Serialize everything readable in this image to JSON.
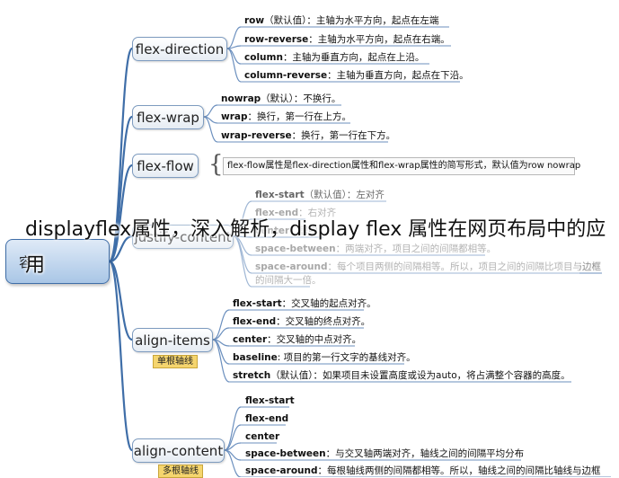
{
  "caption": "displayflex属性，深入解析，display flex 属性在网页布局中的应用",
  "root": {
    "label": "容"
  },
  "branches": [
    {
      "id": "flex-direction",
      "label": "flex-direction",
      "leaves": [
        {
          "key": "row",
          "text": "（默认值）：主轴为水平方向，起点在左端"
        },
        {
          "key": "row-reverse",
          "text": "：主轴为水平方向，起点在右端。"
        },
        {
          "key": "column",
          "text": "：主轴为垂直方向，起点在上沿。"
        },
        {
          "key": "column-reverse",
          "text": "：主轴为垂直方向，起点在下沿。"
        }
      ]
    },
    {
      "id": "flex-wrap",
      "label": "flex-wrap",
      "leaves": [
        {
          "key": "nowrap",
          "text": "（默认）：不换行。"
        },
        {
          "key": "wrap",
          "text": "：换行，第一行在上方。"
        },
        {
          "key": "wrap-reverse",
          "text": "：换行，第一行在下方。"
        }
      ]
    },
    {
      "id": "flex-flow",
      "label": "flex-flow",
      "note": "flex-flow属性是flex-direction属性和flex-wrap属性的简写形式，默认值为row nowrap"
    },
    {
      "id": "justify-content",
      "label": "justify-content",
      "leaves": [
        {
          "key": "flex-start",
          "text": "（默认值）：左对齐"
        },
        {
          "key": "flex-end",
          "text": "：右对齐"
        },
        {
          "key": "center",
          "text": "：居中"
        },
        {
          "key": "space-between",
          "text": "：两端对齐，项目之间的间隔都相等。"
        },
        {
          "key": "space-around",
          "text": "：每个项目两侧的间隔相等。所以，项目之间的间隔比项目与边框"
        },
        {
          "key": "",
          "text": "的间隔大一倍。"
        }
      ]
    },
    {
      "id": "align-items",
      "label": "align-items",
      "tag": "单根轴线",
      "leaves": [
        {
          "key": "flex-start",
          "text": "：交叉轴的起点对齐。"
        },
        {
          "key": "flex-end",
          "text": "：交叉轴的终点对齐。"
        },
        {
          "key": "center",
          "text": "：交叉轴的中点对齐。"
        },
        {
          "key": "baseline",
          "text": ": 项目的第一行文字的基线对齐。"
        },
        {
          "key": "stretch",
          "text": "（默认值）：如果项目未设置高度或设为auto，将占满整个容器的高度。"
        }
      ]
    },
    {
      "id": "align-content",
      "label": "align-content",
      "tag": "多根轴线",
      "leaves": [
        {
          "key": "flex-start",
          "text": ""
        },
        {
          "key": "flex-end",
          "text": ""
        },
        {
          "key": "center",
          "text": ""
        },
        {
          "key": "space-between",
          "text": "：与交叉轴两端对齐，轴线之间的间隔平均分布"
        },
        {
          "key": "space-around",
          "text": "：每根轴线两侧的间隔都相等。所以，轴线之间的间隔比轴线与边框"
        }
      ]
    }
  ]
}
